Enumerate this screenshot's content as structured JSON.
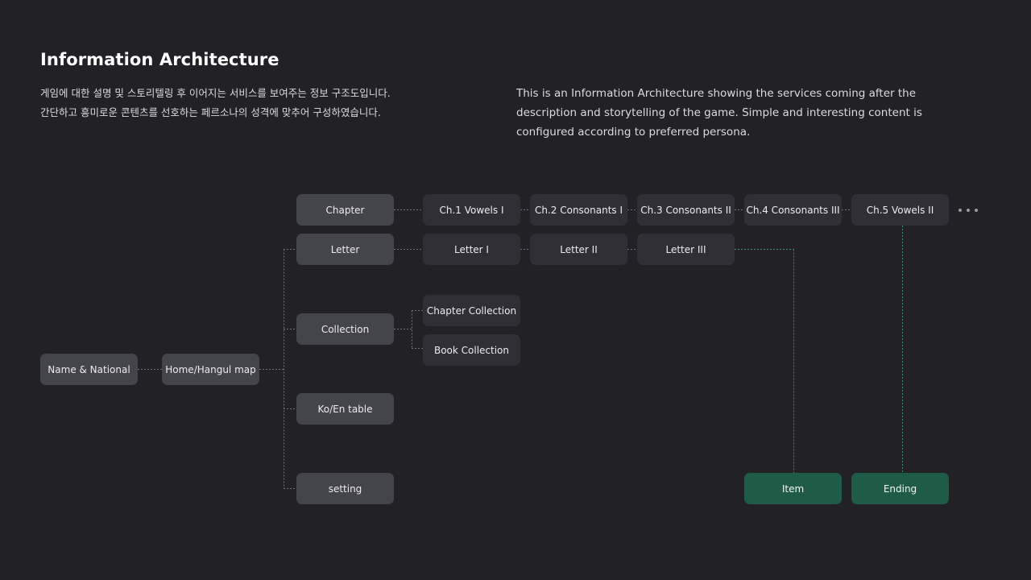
{
  "header": {
    "title": "Information Architecture",
    "description_ko": [
      "게임에 대한 설명 및 스토리텔링 후 이어지는 서비스를 보여주는 정보 구조도입니다.",
      "간단하고 흥미로운 콘텐츠를 선호하는 페르소나의 성격에 맞추어 구성하였습니다."
    ],
    "description_en": [
      "This is an Information Architecture showing the services coming after the",
      "description and storytelling of the game. Simple and interesting content is",
      "configured according to preferred persona."
    ]
  },
  "colors": {
    "background": "#222226",
    "node_main": "#44444b",
    "node_sub": "#2f2f35",
    "node_end": "#1f5c48",
    "link_gray": "#6e6e76",
    "link_green": "#3f8f6f"
  },
  "nodes": {
    "name_national": "Name & National",
    "home_map": "Home/Hangul map",
    "chapter": "Chapter",
    "letter": "Letter",
    "collection": "Collection",
    "ko_en_table": "Ko/En table",
    "setting": "setting",
    "ch1": "Ch.1 Vowels I",
    "ch2": "Ch.2 Consonants I",
    "ch3": "Ch.3 Consonants II",
    "ch4": "Ch.4 Consonants III",
    "ch5": "Ch.5 Vowels II",
    "letter1": "Letter I",
    "letter2": "Letter II",
    "letter3": "Letter III",
    "chapter_collection": "Chapter Collection",
    "book_collection": "Book Collection",
    "item": "Item",
    "ending": "Ending"
  },
  "more_icon": "ellipsis-icon"
}
